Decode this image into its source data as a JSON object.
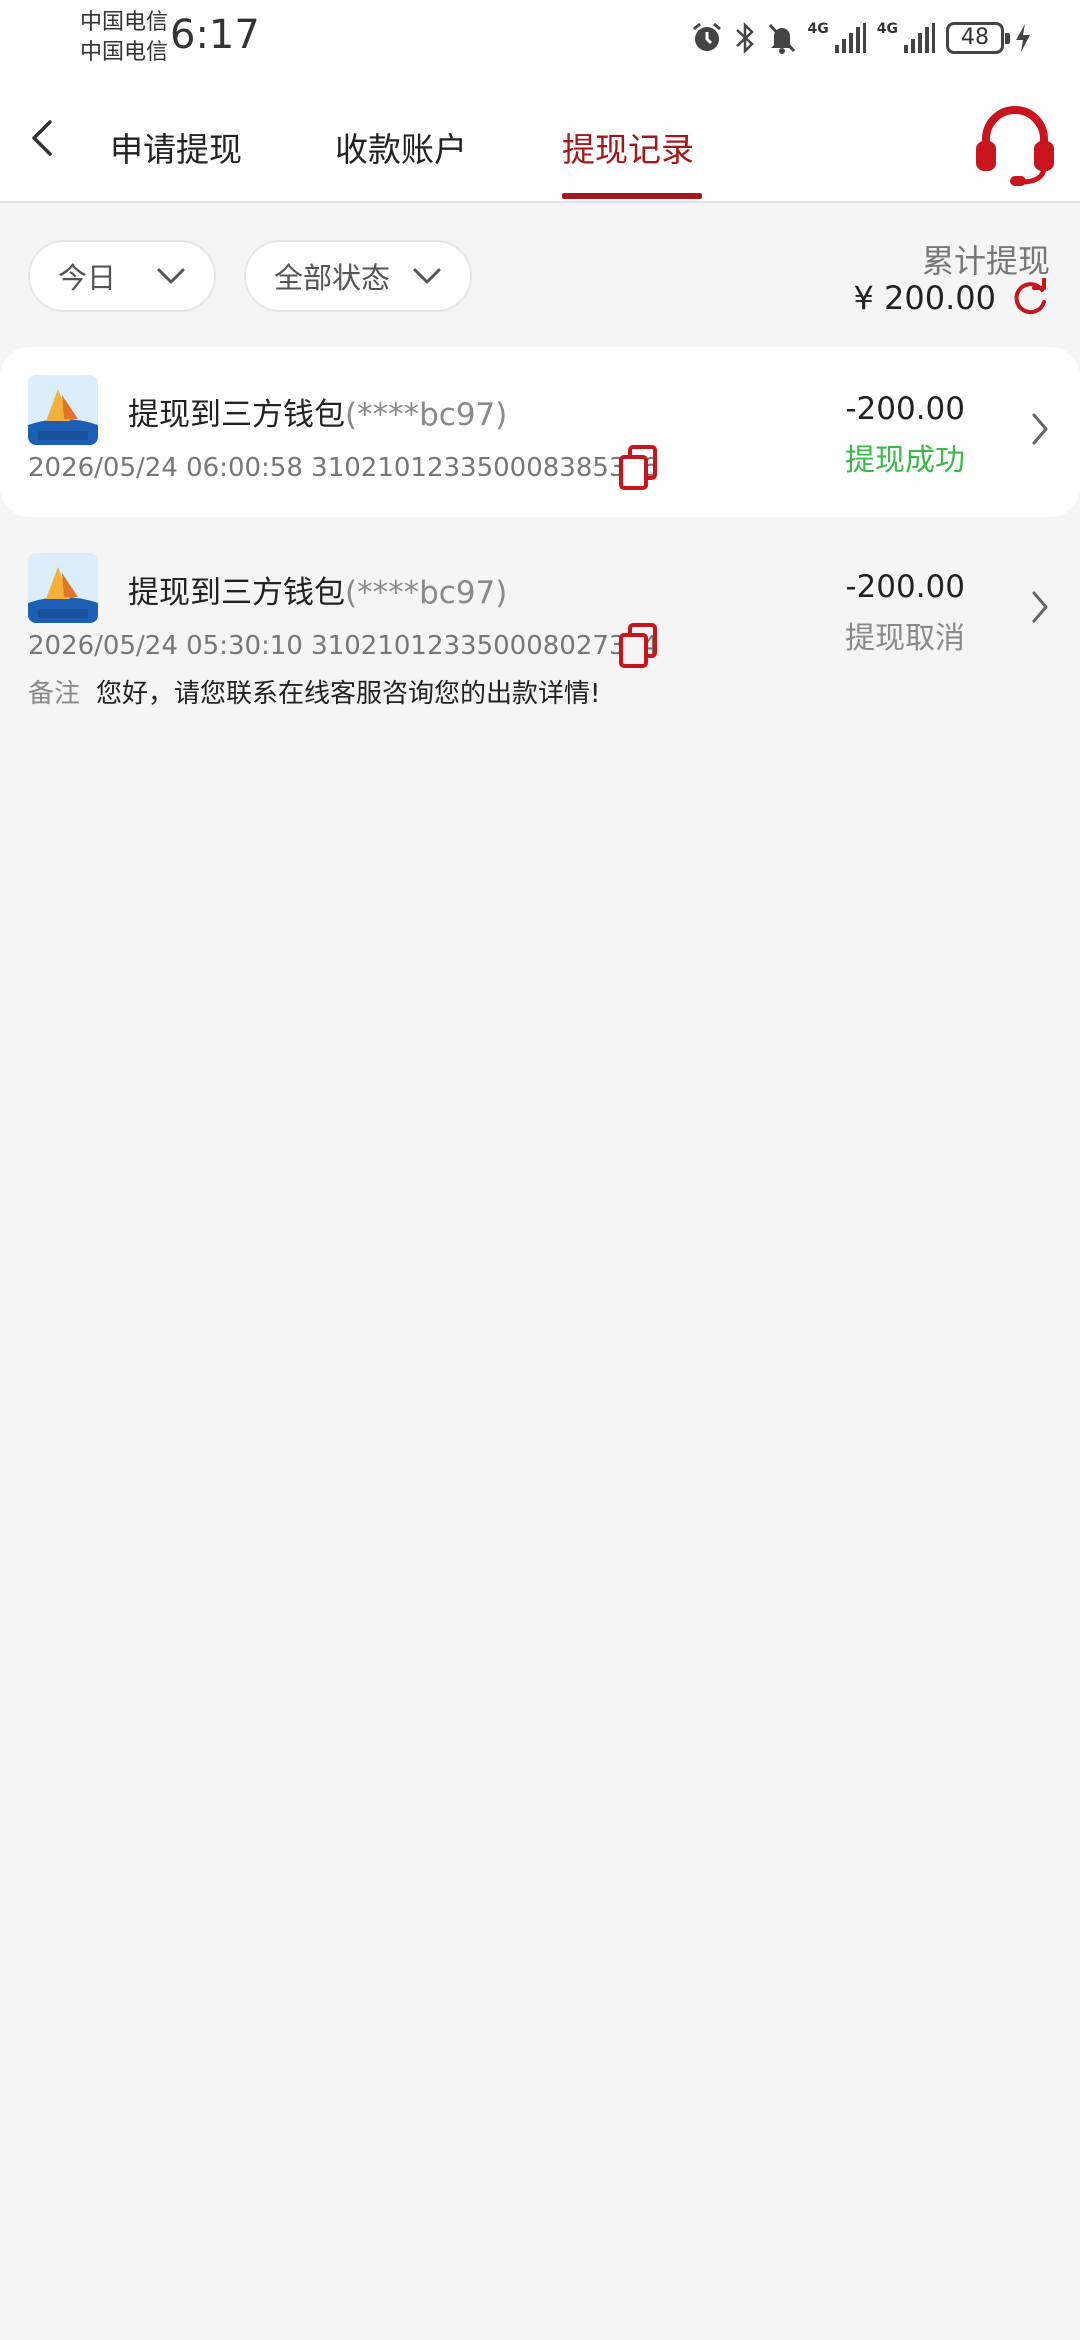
{
  "status_bar": {
    "carrier1": "中国电信",
    "carrier2": "中国电信",
    "time": "6:17",
    "net1": "4G",
    "net2": "4G",
    "battery": "48"
  },
  "header": {
    "tabs": [
      {
        "label": "申请提现"
      },
      {
        "label": "收款账户"
      },
      {
        "label": "提现记录"
      }
    ],
    "active_tab": 2,
    "accent_color": "#a3181c"
  },
  "filters": {
    "date": "今日",
    "status": "全部状态"
  },
  "summary": {
    "label": "累计提现",
    "value": "¥ 200.00"
  },
  "records": [
    {
      "title": "提现到三方钱包",
      "account_mask": "(****bc97)",
      "datetime": "2026/05/24 06:00:58",
      "order_no": "310210123350008385376",
      "amount": "-200.00",
      "status": "提现成功",
      "status_color": "#3cb94a"
    },
    {
      "title": "提现到三方钱包",
      "account_mask": "(****bc97)",
      "datetime": "2026/05/24 05:30:10",
      "order_no": "310210123350008027314",
      "amount": "-200.00",
      "status": "提现取消",
      "status_color": "#8a8a8a",
      "remark_label": "备注",
      "remark": "您好，请您联系在线客服咨询您的出款详情!"
    }
  ],
  "icons": {
    "back": "chevron-left-icon",
    "support": "headset-icon",
    "refresh": "refresh-icon",
    "copy": "copy-icon",
    "wallet_logo": "wallet-app-logo"
  }
}
